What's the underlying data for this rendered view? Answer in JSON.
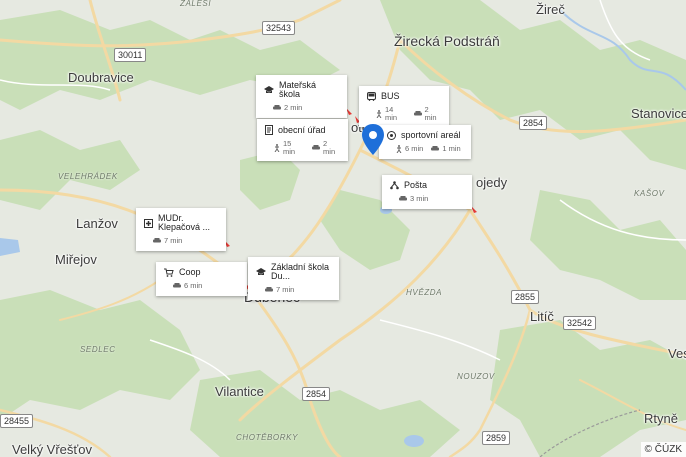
{
  "map": {
    "towns": {
      "zirec": "Žireč",
      "zirecka_podstran": "Žirecká Podstráň",
      "doubravice": "Doubravice",
      "stanovice": "Stanovice",
      "lanzov": "Lanžov",
      "mirejov": "Miřejov",
      "dubenec": "Dubenec",
      "litic": "Litíč",
      "ves": "Ves",
      "vilantice": "Vilantice",
      "rtyne": "Rtyně",
      "velky_vrestov": "Velký Vřešťov",
      "bojedy_partial": "ojedy",
      "kotov_partial": "otov"
    },
    "localities": {
      "zalesi": "ZÁLESÍ",
      "velehradek": "VELEHRÁDEK",
      "kasov": "KAŠOV",
      "hvezda": "HVĚZDA",
      "sedlec": "SEDLEC",
      "nouzov": "NOUZOV",
      "chotebörky": "CHOTĚBORKY"
    },
    "road_numbers": [
      "32543",
      "30011",
      "2854",
      "2855",
      "32542",
      "2854",
      "28455",
      "2859"
    ],
    "copyright": "© ČÚZK"
  },
  "pois": [
    {
      "id": "materska-skola",
      "icon": "school-icon",
      "name": "Mateřská škola",
      "times": [
        {
          "mode": "car-icon",
          "text": "2 min"
        }
      ]
    },
    {
      "id": "bus",
      "icon": "bus-icon",
      "name": "BUS",
      "times": [
        {
          "mode": "walk-icon",
          "text": "14 min"
        },
        {
          "mode": "car-icon",
          "text": "2 min"
        }
      ]
    },
    {
      "id": "obecni-urad",
      "icon": "document-icon",
      "name": "obecní úřad",
      "times": [
        {
          "mode": "walk-icon",
          "text": "15 min"
        },
        {
          "mode": "car-icon",
          "text": "2 min"
        }
      ]
    },
    {
      "id": "sportovni-areal",
      "icon": "ball-icon",
      "name": "sportovní areál",
      "times": [
        {
          "mode": "walk-icon",
          "text": "6 min"
        },
        {
          "mode": "car-icon",
          "text": "1 min"
        }
      ]
    },
    {
      "id": "posta",
      "icon": "post-icon",
      "name": "Pošta",
      "times": [
        {
          "mode": "car-icon",
          "text": "3 min"
        }
      ]
    },
    {
      "id": "mudr",
      "icon": "medical-icon",
      "name": "MUDr. Klepačová ...",
      "times": [
        {
          "mode": "car-icon",
          "text": "7 min"
        }
      ]
    },
    {
      "id": "coop",
      "icon": "cart-icon",
      "name": "Coop",
      "times": [
        {
          "mode": "car-icon",
          "text": "6 min"
        }
      ]
    },
    {
      "id": "zakladni-skola",
      "icon": "school-icon",
      "name": "Základní škola Du...",
      "times": [
        {
          "mode": "car-icon",
          "text": "7 min"
        }
      ]
    }
  ]
}
